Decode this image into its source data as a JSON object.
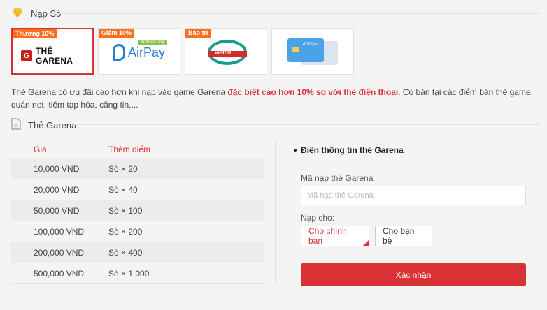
{
  "header": {
    "title": "Nạp Sò",
    "icon": "shell-icon",
    "icon_color": "#f5c342"
  },
  "payment_methods": [
    {
      "tag": "Thưởng 10%",
      "name": "THẺ GARENA",
      "selected": true
    },
    {
      "tag": "Giảm 10%",
      "name": "AirPay",
      "badge": "Android Only",
      "selected": false
    },
    {
      "tag": "Bảo trì",
      "name": "viettel",
      "selected": false
    },
    {
      "tag": "",
      "name": "ATM Card",
      "selected": false
    }
  ],
  "description": {
    "before": "Thẻ Garena có ưu đãi cao hơn khi nạp vào game Garena ",
    "highlight": "đặc biệt cao hơn 10% so với thẻ điện thoại",
    "after": ". Có bán tại các điểm bán thẻ game: quán net, tiệm tạp hóa, căng tin,..."
  },
  "garena_section": {
    "title": "Thẻ Garena",
    "icon": "document-icon"
  },
  "price_table": {
    "headers": [
      "Giá",
      "Thêm điểm"
    ],
    "rows": [
      [
        "10,000 VND",
        "Sò × 20"
      ],
      [
        "20,000 VND",
        "Sò × 40"
      ],
      [
        "50,000 VND",
        "Sò × 100"
      ],
      [
        "100,000 VND",
        "Sò × 200"
      ],
      [
        "200,000 VND",
        "Sò × 400"
      ],
      [
        "500,000 VND",
        "Sò × 1,000"
      ]
    ]
  },
  "form": {
    "title": "Điền thông tin thẻ Garena",
    "code_label": "Mã nạp thẻ Garena",
    "code_placeholder": "Mã nạp thẻ Garena",
    "code_value": "",
    "recipient_label": "Nạp cho:",
    "option_self": "Cho chính bạn",
    "option_friend": "Cho bạn bè",
    "submit": "Xác nhận"
  },
  "colors": {
    "accent": "#d93236",
    "tag": "#ff6d1f"
  }
}
